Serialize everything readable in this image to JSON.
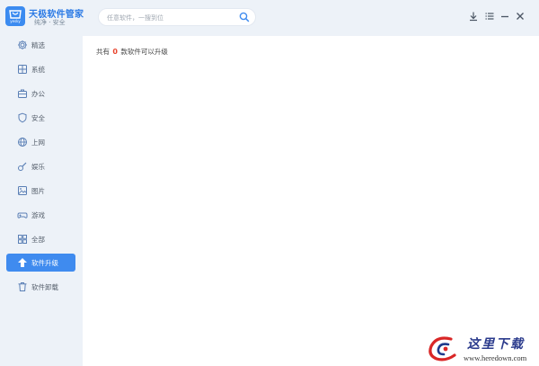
{
  "header": {
    "logo_text": "yesky",
    "title": "天极软件管家",
    "subtitle": "纯净 · 安全",
    "search_placeholder": "任意软件，一搜到位"
  },
  "window_controls": {
    "download_icon": "download-icon",
    "menu_icon": "menu-icon",
    "minimize_icon": "minimize-icon",
    "close_icon": "close-icon"
  },
  "sidebar": {
    "items": [
      {
        "label": "精选",
        "icon": "gear-icon"
      },
      {
        "label": "系统",
        "icon": "window-icon"
      },
      {
        "label": "办公",
        "icon": "briefcase-icon"
      },
      {
        "label": "安全",
        "icon": "shield-icon"
      },
      {
        "label": "上网",
        "icon": "globe-icon"
      },
      {
        "label": "娱乐",
        "icon": "guitar-icon"
      },
      {
        "label": "图片",
        "icon": "image-icon"
      },
      {
        "label": "游戏",
        "icon": "gamepad-icon"
      },
      {
        "label": "全部",
        "icon": "grid-icon"
      },
      {
        "label": "软件升级",
        "icon": "upgrade-arrow-icon",
        "active": true
      },
      {
        "label": "软件卸载",
        "icon": "trash-icon"
      }
    ]
  },
  "main": {
    "summary_prefix": "共有",
    "summary_count": "0",
    "summary_suffix": "款软件可以升级"
  },
  "watermark": {
    "title": "这里下载",
    "url": "www.heredown.com"
  },
  "colors": {
    "accent": "#3f8bef",
    "brand": "#2d7be5",
    "count_red": "#e8452e",
    "sidebar_bg": "#edf2f8"
  }
}
